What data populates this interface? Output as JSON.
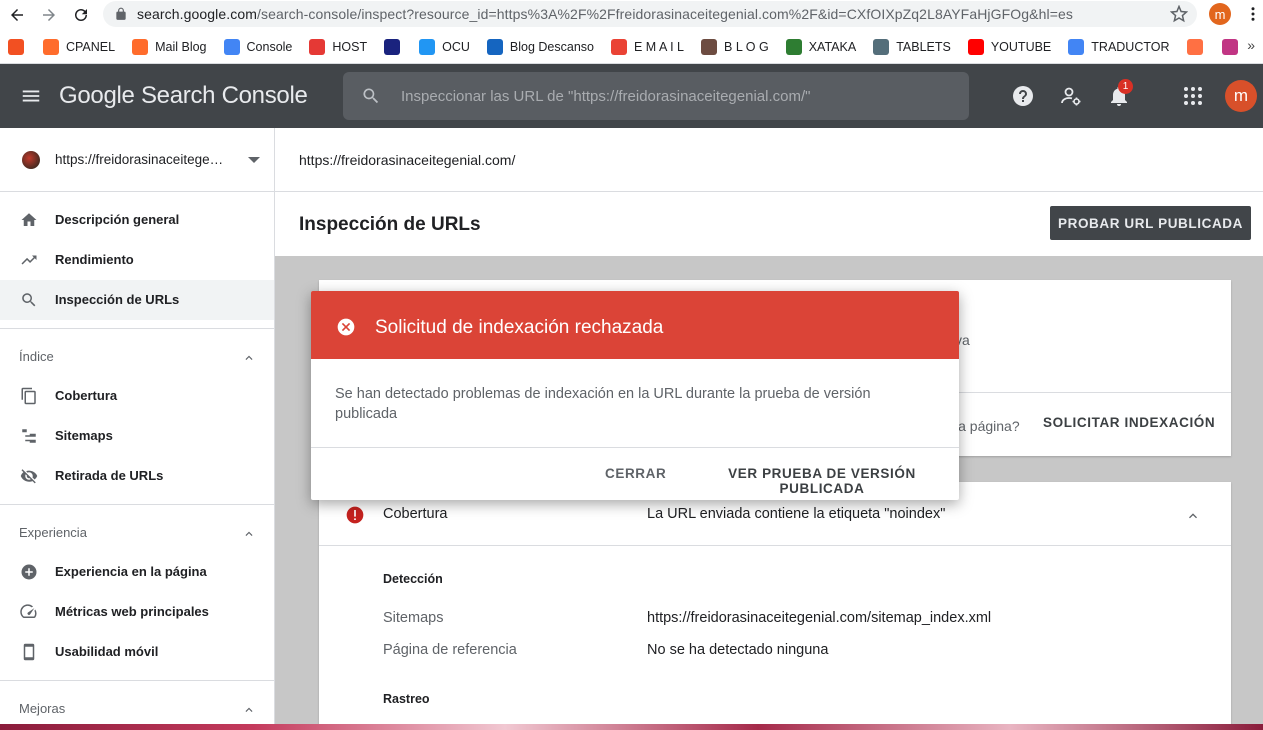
{
  "browser": {
    "url_host": "search.google.com",
    "url_path": "/search-console/inspect?resource_id=https%3A%2F%2Ffreidorasinaceitegenial.com%2F&id=CXfOIXpZq2L8AYFaHjGFOg&hl=es",
    "profile_initial": "m",
    "bookmarks": [
      {
        "label": "",
        "color": "#f25022"
      },
      {
        "label": "CPANEL",
        "color": "#ff6c2c"
      },
      {
        "label": "Mail Blog",
        "color": "#ff6c2c"
      },
      {
        "label": "Console",
        "color": "#4285f4"
      },
      {
        "label": "HOST",
        "color": "#e53935"
      },
      {
        "label": "",
        "color": "#1a237e"
      },
      {
        "label": "OCU",
        "color": "#2196f3"
      },
      {
        "label": "Blog Descanso",
        "color": "#1565c0"
      },
      {
        "label": "E M A I L",
        "color": "#ea4335"
      },
      {
        "label": "B L O G",
        "color": "#6d4c41"
      },
      {
        "label": "XATAKA",
        "color": "#2e7d32"
      },
      {
        "label": "TABLETS",
        "color": "#546e7a"
      },
      {
        "label": "YOUTUBE",
        "color": "#ff0000"
      },
      {
        "label": "TRADUCTOR",
        "color": "#4285f4"
      },
      {
        "label": "",
        "color": "#ff7043"
      },
      {
        "label": "",
        "color": "#c13584"
      }
    ],
    "bookmarks_more": "»"
  },
  "header": {
    "logo": "Google Search Console",
    "search_placeholder": "Inspeccionar las URL de \"https://freidorasinaceitegenial.com/\"",
    "notification_count": "1",
    "avatar_initial": "m"
  },
  "sidebar": {
    "property": "https://freidorasinaceitegenial.com/",
    "items": [
      {
        "label": "Descripción general"
      },
      {
        "label": "Rendimiento"
      },
      {
        "label": "Inspección de URLs"
      }
    ],
    "sections": [
      {
        "label": "Índice",
        "items": [
          {
            "label": "Cobertura"
          },
          {
            "label": "Sitemaps"
          },
          {
            "label": "Retirada de URLs"
          }
        ]
      },
      {
        "label": "Experiencia",
        "items": [
          {
            "label": "Experiencia en la página"
          },
          {
            "label": "Métricas web principales"
          },
          {
            "label": "Usabilidad móvil"
          }
        ]
      },
      {
        "label": "Mejoras"
      }
    ]
  },
  "main": {
    "inspected_url": "https://freidorasinaceitegenial.com/",
    "title": "Inspección de URLs",
    "test_live_label": "PROBAR URL PUBLICADA",
    "card1_partial": "va",
    "card1_ask": "la página?",
    "request_indexing_label": "SOLICITAR INDEXACIÓN",
    "coverage": {
      "label": "Cobertura",
      "value": "La URL enviada contiene la etiqueta \"noindex\""
    },
    "detection_header": "Detección",
    "rows": [
      {
        "key": "Sitemaps",
        "value": "https://freidorasinaceitegenial.com/sitemap_index.xml"
      },
      {
        "key": "Página de referencia",
        "value": "No se ha detectado ninguna"
      }
    ],
    "crawl_header": "Rastreo"
  },
  "dialog": {
    "title": "Solicitud de indexación rechazada",
    "body": "Se han detectado problemas de indexación en la URL durante la prueba de versión publicada",
    "close_label": "CERRAR",
    "view_label": "VER PRUEBA DE VERSIÓN PUBLICADA"
  },
  "colors": {
    "header_bg": "#414549",
    "dialog_header": "#db4437",
    "error_red": "#c5221f"
  }
}
